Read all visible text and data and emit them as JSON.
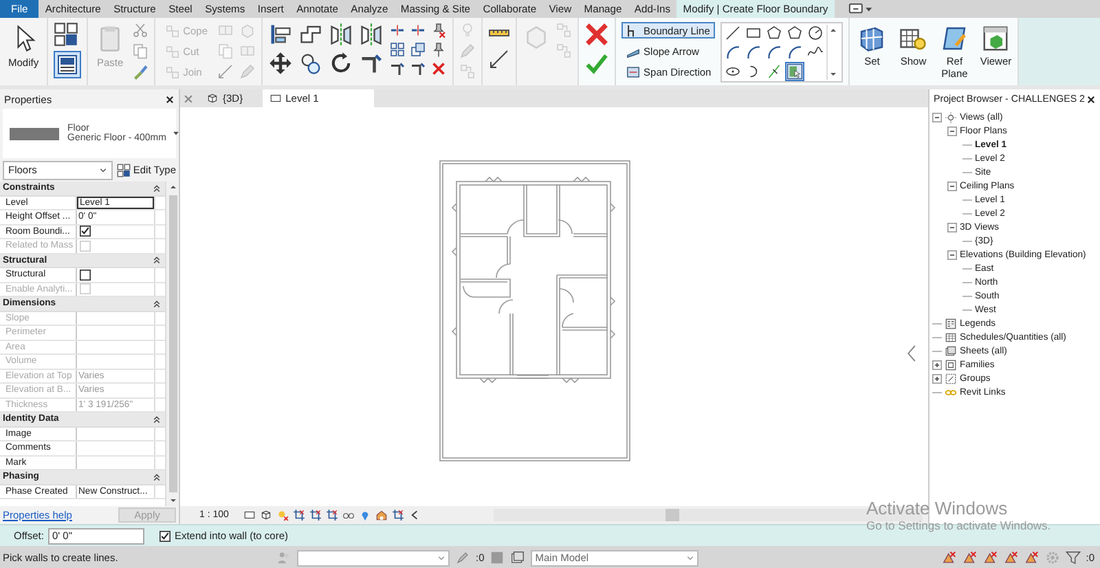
{
  "menu_tabs": [
    {
      "label": "File",
      "kind": "file",
      "selected": false
    },
    {
      "label": "Architecture",
      "kind": "tab",
      "selected": false
    },
    {
      "label": "Structure",
      "kind": "tab",
      "selected": false
    },
    {
      "label": "Steel",
      "kind": "tab",
      "selected": false
    },
    {
      "label": "Systems",
      "kind": "tab",
      "selected": false
    },
    {
      "label": "Insert",
      "kind": "tab",
      "selected": false
    },
    {
      "label": "Annotate",
      "kind": "tab",
      "selected": false
    },
    {
      "label": "Analyze",
      "kind": "tab",
      "selected": false
    },
    {
      "label": "Massing & Site",
      "kind": "tab",
      "selected": false
    },
    {
      "label": "Collaborate",
      "kind": "tab",
      "selected": false
    },
    {
      "label": "View",
      "kind": "tab",
      "selected": false
    },
    {
      "label": "Manage",
      "kind": "tab",
      "selected": false
    },
    {
      "label": "Add-Ins",
      "kind": "tab",
      "selected": false
    },
    {
      "label": "Modify | Create Floor Boundary",
      "kind": "context",
      "selected": true
    }
  ],
  "ribbon": {
    "modify": "Modify",
    "properties_palette": {
      "on": true
    },
    "paste": {
      "label": "Paste",
      "disabled": true
    },
    "geometry": [
      {
        "label": "Cope",
        "disabled": true
      },
      {
        "label": "Cut",
        "disabled": true
      },
      {
        "label": "Join",
        "disabled": true
      }
    ],
    "draw_modes": [
      {
        "label": "Boundary Line",
        "kind": "boundary",
        "selected": true
      },
      {
        "label": "Slope Arrow",
        "kind": "slope",
        "selected": false
      },
      {
        "label": "Span Direction",
        "kind": "span",
        "selected": false
      }
    ],
    "work_plane": [
      {
        "label": "Set",
        "kind": "set"
      },
      {
        "label": "Show",
        "kind": "show"
      },
      {
        "label": "Ref Plane",
        "kind": "ref_plane"
      },
      {
        "label": "Viewer",
        "kind": "viewer"
      }
    ]
  },
  "properties": {
    "title": "Properties",
    "type_family": "Floor",
    "type_name": "Generic Floor - 400mm",
    "category": "Floors",
    "edit_type": "Edit Type",
    "sections": [
      {
        "title": "Constraints",
        "rows": [
          {
            "label": "Level",
            "kind": "text",
            "value": "Level 1",
            "focused": true,
            "disabled": false
          },
          {
            "label": "Height Offset ...",
            "kind": "text",
            "value": "0'  0\"",
            "focused": false,
            "disabled": false
          },
          {
            "label": "Room Boundi...",
            "kind": "checkbox",
            "checked": true,
            "disabled": false
          },
          {
            "label": "Related to Mass",
            "kind": "checkbox",
            "checked": false,
            "disabled": true
          }
        ]
      },
      {
        "title": "Structural",
        "rows": [
          {
            "label": "Structural",
            "kind": "checkbox",
            "checked": false,
            "disabled": false
          },
          {
            "label": "Enable Analyti...",
            "kind": "checkbox",
            "checked": false,
            "disabled": true
          }
        ]
      },
      {
        "title": "Dimensions",
        "rows": [
          {
            "label": "Slope",
            "kind": "text",
            "value": "",
            "focused": false,
            "disabled": true
          },
          {
            "label": "Perimeter",
            "kind": "text",
            "value": "",
            "focused": false,
            "disabled": true
          },
          {
            "label": "Area",
            "kind": "text",
            "value": "",
            "focused": false,
            "disabled": true
          },
          {
            "label": "Volume",
            "kind": "text",
            "value": "",
            "focused": false,
            "disabled": true
          },
          {
            "label": "Elevation at Top",
            "kind": "text",
            "value": "Varies",
            "focused": false,
            "disabled": true
          },
          {
            "label": "Elevation at B...",
            "kind": "text",
            "value": "Varies",
            "focused": false,
            "disabled": true
          },
          {
            "label": "Thickness",
            "kind": "text",
            "value": "1'  3 191/256\"",
            "focused": false,
            "disabled": true
          }
        ]
      },
      {
        "title": "Identity Data",
        "rows": [
          {
            "label": "Image",
            "kind": "text",
            "value": "",
            "focused": false,
            "disabled": false
          },
          {
            "label": "Comments",
            "kind": "text",
            "value": "",
            "focused": false,
            "disabled": false
          },
          {
            "label": "Mark",
            "kind": "text",
            "value": "",
            "focused": false,
            "disabled": false
          }
        ]
      },
      {
        "title": "Phasing",
        "rows": [
          {
            "label": "Phase Created",
            "kind": "text",
            "value": "New Construct...",
            "focused": false,
            "disabled": false
          }
        ]
      }
    ],
    "help": "Properties help",
    "apply": {
      "label": "Apply",
      "disabled": true
    }
  },
  "view": {
    "tabs": [
      {
        "label": "{3D}",
        "kind": "model",
        "selected": false
      },
      {
        "label": "Level 1",
        "kind": "plan",
        "selected": true
      }
    ],
    "scale": "1 : 100"
  },
  "project_browser": {
    "title": "Project Browser - CHALLENGES 2",
    "tree": [
      {
        "label": "Views (all)",
        "kind": "views",
        "expanded": true,
        "selected": false,
        "children": [
          {
            "label": "Floor Plans",
            "expanded": true,
            "selected": false,
            "children": [
              {
                "label": "Level 1",
                "selected": true
              },
              {
                "label": "Level 2",
                "selected": false
              },
              {
                "label": "Site",
                "selected": false
              }
            ]
          },
          {
            "label": "Ceiling Plans",
            "expanded": true,
            "selected": false,
            "children": [
              {
                "label": "Level 1",
                "selected": false
              },
              {
                "label": "Level 2",
                "selected": false
              }
            ]
          },
          {
            "label": "3D Views",
            "expanded": true,
            "selected": false,
            "children": [
              {
                "label": "{3D}",
                "selected": false
              }
            ]
          },
          {
            "label": "Elevations (Building Elevation)",
            "expanded": true,
            "selected": false,
            "children": [
              {
                "label": "East",
                "selected": false
              },
              {
                "label": "North",
                "selected": false
              },
              {
                "label": "South",
                "selected": false
              },
              {
                "label": "West",
                "selected": false
              }
            ]
          }
        ]
      },
      {
        "label": "Legends",
        "kind": "legends",
        "selected": false
      },
      {
        "label": "Schedules/Quantities (all)",
        "kind": "schedules",
        "selected": false
      },
      {
        "label": "Sheets (all)",
        "kind": "sheets",
        "selected": false
      },
      {
        "label": "Families",
        "kind": "families",
        "expanded": false,
        "selected": false
      },
      {
        "label": "Groups",
        "kind": "groups",
        "expanded": false,
        "selected": false
      },
      {
        "label": "Revit Links",
        "kind": "links",
        "selected": false
      }
    ]
  },
  "options_bar": {
    "offset_label": "Offset:",
    "offset_value": "0'  0\"",
    "extend": {
      "label": "Extend into wall (to core)",
      "checked": true
    }
  },
  "status_bar": {
    "prompt": "Pick walls to create lines.",
    "editable_count": ":0",
    "design_option": "Main Model",
    "filter_count": ":0"
  },
  "activation_notice": {
    "title": "Activate Windows",
    "subtitle": "Go to Settings to activate Windows."
  }
}
